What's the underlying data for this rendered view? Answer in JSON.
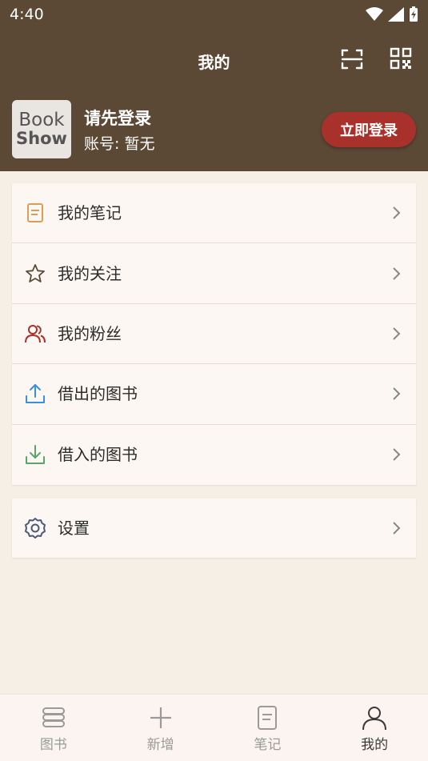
{
  "status_bar": {
    "time": "4:40"
  },
  "header": {
    "title": "我的"
  },
  "profile": {
    "avatar_line1": "Book",
    "avatar_line2": "Show",
    "name": "请先登录",
    "account": "账号: 暂无",
    "login_button": "立即登录"
  },
  "menu": [
    {
      "label": "我的笔记",
      "icon": "note-icon"
    },
    {
      "label": "我的关注",
      "icon": "star-icon"
    },
    {
      "label": "我的粉丝",
      "icon": "fans-icon"
    },
    {
      "label": "借出的图书",
      "icon": "upload-icon"
    },
    {
      "label": "借入的图书",
      "icon": "download-icon"
    }
  ],
  "settings": {
    "label": "设置",
    "icon": "gear-icon"
  },
  "tabs": [
    {
      "label": "图书",
      "icon": "books-icon"
    },
    {
      "label": "新增",
      "icon": "plus-icon"
    },
    {
      "label": "笔记",
      "icon": "note-icon"
    },
    {
      "label": "我的",
      "icon": "person-icon",
      "active": true
    }
  ],
  "colors": {
    "header_bg": "#5c4935",
    "page_bg": "#f6efe6",
    "login_button": "#a8312b",
    "note_icon": "#d9a055",
    "fans_icon": "#a8312b",
    "upload_icon": "#3b8ed8",
    "download_icon": "#5aa36a"
  }
}
